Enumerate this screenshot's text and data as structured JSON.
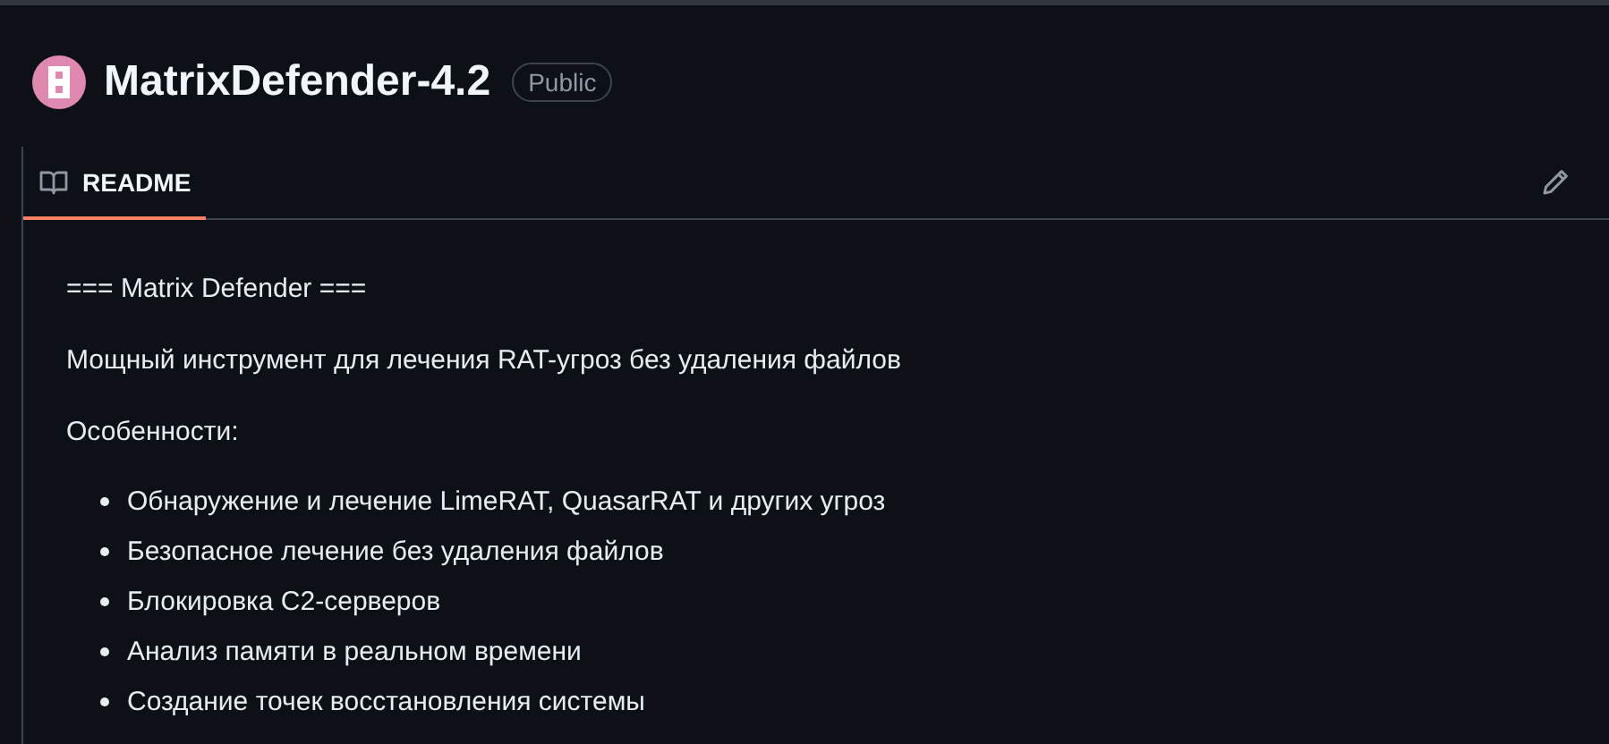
{
  "repo": {
    "name": "MatrixDefender-4.2",
    "visibility": "Public"
  },
  "tabs": [
    {
      "label": "README",
      "selected": true
    }
  ],
  "readme": {
    "paragraphs": [
      "=== Matrix Defender ===",
      "Мощный инструмент для лечения RAT-угроз без удаления файлов",
      "Особенности:"
    ],
    "list": [
      "Обнаружение и лечение LimeRAT, QuasarRAT и других угроз",
      "Безопасное лечение без удаления файлов",
      "Блокировка C2-серверов",
      "Анализ памяти в реальном времени",
      "Создание точек восстановления системы"
    ]
  }
}
